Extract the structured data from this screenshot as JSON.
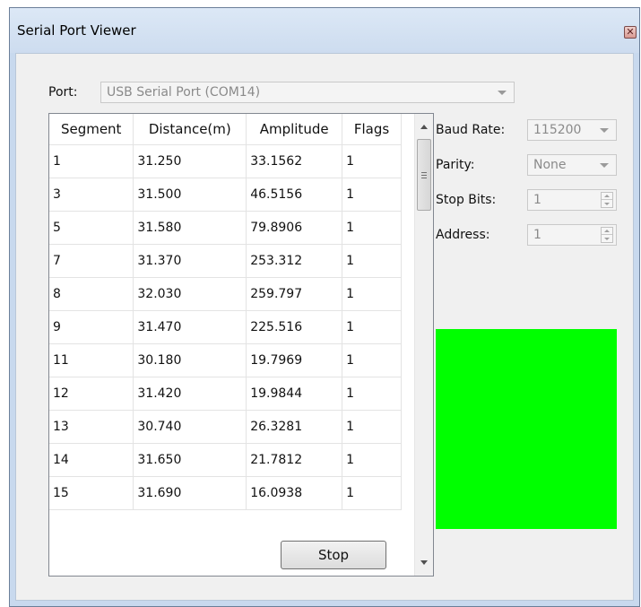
{
  "window": {
    "title": "Serial Port Viewer"
  },
  "port": {
    "label": "Port:",
    "value": "USB Serial Port (COM14)"
  },
  "settings": {
    "baud_rate": {
      "label": "Baud Rate:",
      "value": "115200"
    },
    "parity": {
      "label": "Parity:",
      "value": "None"
    },
    "stop_bits": {
      "label": "Stop Bits:",
      "value": "1"
    },
    "address": {
      "label": "Address:",
      "value": "1"
    }
  },
  "table": {
    "headers": [
      "Segment",
      "Distance(m)",
      "Amplitude",
      "Flags"
    ],
    "rows": [
      [
        "1",
        "31.250",
        "33.1562",
        "1"
      ],
      [
        "3",
        "31.500",
        "46.5156",
        "1"
      ],
      [
        "5",
        "31.580",
        "79.8906",
        "1"
      ],
      [
        "7",
        "31.370",
        "253.312",
        "1"
      ],
      [
        "8",
        "32.030",
        "259.797",
        "1"
      ],
      [
        "9",
        "31.470",
        "225.516",
        "1"
      ],
      [
        "11",
        "30.180",
        "19.7969",
        "1"
      ],
      [
        "12",
        "31.420",
        "19.9844",
        "1"
      ],
      [
        "13",
        "30.740",
        "26.3281",
        "1"
      ],
      [
        "14",
        "31.650",
        "21.7812",
        "1"
      ],
      [
        "15",
        "31.690",
        "16.0938",
        "1"
      ]
    ]
  },
  "indicator": {
    "color": "#00ff00"
  },
  "actions": {
    "stop_label": "Stop"
  },
  "icons": {
    "close": "close-icon",
    "dropdown": "chevron-down-icon"
  }
}
